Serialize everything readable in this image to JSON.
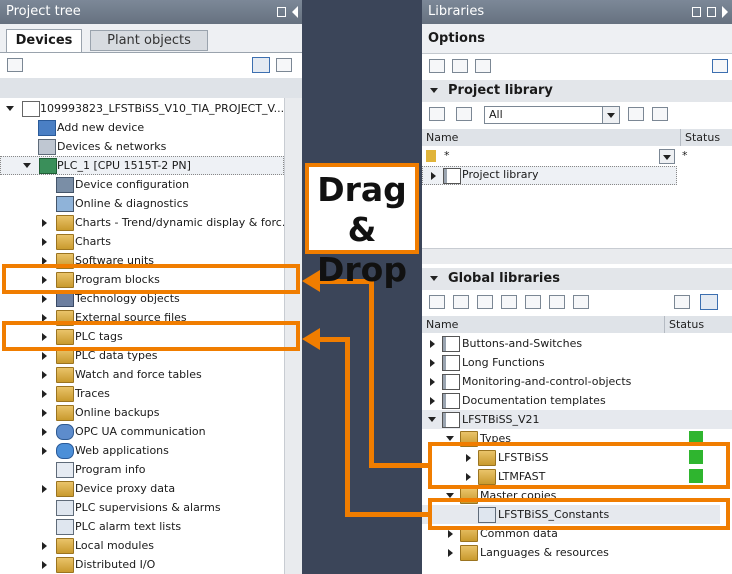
{
  "project_tree": {
    "title": "Project tree",
    "tabs": [
      {
        "label": "Devices"
      },
      {
        "label": "Plant objects"
      }
    ],
    "root": "109993823_LFSTBiSS_V10_TIA_PROJECT_V...",
    "items": [
      {
        "label": "Add new device"
      },
      {
        "label": "Devices & networks"
      },
      {
        "label": "PLC_1 [CPU 1515T-2 PN]"
      },
      {
        "label": "Device configuration"
      },
      {
        "label": "Online & diagnostics"
      },
      {
        "label": "Charts - Trend/dynamic display & forc..."
      },
      {
        "label": "Charts"
      },
      {
        "label": "Software units"
      },
      {
        "label": "Program blocks"
      },
      {
        "label": "Technology objects"
      },
      {
        "label": "External source files"
      },
      {
        "label": "PLC tags"
      },
      {
        "label": "PLC data types"
      },
      {
        "label": "Watch and force tables"
      },
      {
        "label": "Traces"
      },
      {
        "label": "Online backups"
      },
      {
        "label": "OPC UA communication"
      },
      {
        "label": "Web applications"
      },
      {
        "label": "Program info"
      },
      {
        "label": "Device proxy data"
      },
      {
        "label": "PLC supervisions & alarms"
      },
      {
        "label": "PLC alarm text lists"
      },
      {
        "label": "Local modules"
      },
      {
        "label": "Distributed I/O"
      }
    ]
  },
  "libraries": {
    "title": "Libraries",
    "options_label": "Options",
    "project_library": {
      "title": "Project library",
      "filter_value": "All",
      "col_name": "Name",
      "col_status": "Status",
      "filter_name": "*",
      "filter_status": "*",
      "items": [
        {
          "label": "Project library"
        }
      ]
    },
    "global_libraries": {
      "title": "Global libraries",
      "col_name": "Name",
      "col_status": "Status",
      "items": [
        {
          "label": "Buttons-and-Switches"
        },
        {
          "label": "Long Functions"
        },
        {
          "label": "Monitoring-and-control-objects"
        },
        {
          "label": "Documentation templates"
        },
        {
          "label": "LFSTBiSS_V21"
        },
        {
          "label": "Types"
        },
        {
          "label": "LFSTBiSS"
        },
        {
          "label": "LTMFAST"
        },
        {
          "label": "Master copies"
        },
        {
          "label": "LFSTBiSS_Constants"
        },
        {
          "label": "Common data"
        },
        {
          "label": "Languages & resources"
        }
      ]
    }
  },
  "callout": {
    "line1": "Drag &",
    "line2": "Drop"
  },
  "colors": {
    "accent": "#f07d00",
    "status_ok": "#2fb52f",
    "titlebar": "#6e7a89",
    "gap": "#3b4559"
  }
}
